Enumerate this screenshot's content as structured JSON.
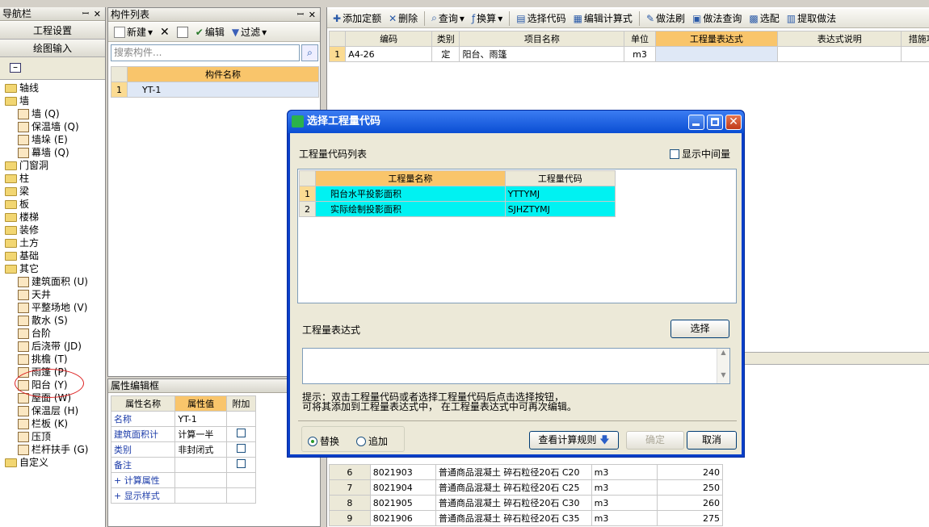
{
  "left_panel": {
    "title": "导航栏",
    "buttons": [
      "工程设置",
      "绘图输入"
    ],
    "tree": [
      {
        "label": "轴线",
        "type": "folder",
        "level": 0
      },
      {
        "label": "墙",
        "type": "folder",
        "level": 0
      },
      {
        "label": "墙 (Q)",
        "type": "item",
        "level": 1
      },
      {
        "label": "保温墙 (Q)",
        "type": "item",
        "level": 1
      },
      {
        "label": "墙垛 (E)",
        "type": "item",
        "level": 1
      },
      {
        "label": "幕墙 (Q)",
        "type": "item",
        "level": 1
      },
      {
        "label": "门窗洞",
        "type": "folder",
        "level": 0
      },
      {
        "label": "柱",
        "type": "folder",
        "level": 0
      },
      {
        "label": "梁",
        "type": "folder",
        "level": 0
      },
      {
        "label": "板",
        "type": "folder",
        "level": 0
      },
      {
        "label": "楼梯",
        "type": "folder",
        "level": 0
      },
      {
        "label": "装修",
        "type": "folder",
        "level": 0
      },
      {
        "label": "土方",
        "type": "folder",
        "level": 0
      },
      {
        "label": "基础",
        "type": "folder",
        "level": 0
      },
      {
        "label": "其它",
        "type": "folder",
        "level": 0
      },
      {
        "label": "建筑面积 (U)",
        "type": "item",
        "level": 1
      },
      {
        "label": "天井",
        "type": "item",
        "level": 1
      },
      {
        "label": "平整场地 (V)",
        "type": "item",
        "level": 1
      },
      {
        "label": "散水 (S)",
        "type": "item",
        "level": 1
      },
      {
        "label": "台阶",
        "type": "item",
        "level": 1
      },
      {
        "label": "后浇带 (JD)",
        "type": "item",
        "level": 1
      },
      {
        "label": "挑檐 (T)",
        "type": "item",
        "level": 1
      },
      {
        "label": "雨篷 (P)",
        "type": "item",
        "level": 1
      },
      {
        "label": "阳台 (Y)",
        "type": "item",
        "level": 1
      },
      {
        "label": "屋面 (W)",
        "type": "item",
        "level": 1
      },
      {
        "label": "保温层 (H)",
        "type": "item",
        "level": 1
      },
      {
        "label": "栏板 (K)",
        "type": "item",
        "level": 1
      },
      {
        "label": "压顶",
        "type": "item",
        "level": 1
      },
      {
        "label": "栏杆扶手 (G)",
        "type": "item",
        "level": 1
      },
      {
        "label": "自定义",
        "type": "folder",
        "level": 0
      }
    ]
  },
  "component_list": {
    "title": "构件列表",
    "toolbar": {
      "new": "新建",
      "edit": "编辑",
      "filter": "过滤"
    },
    "search_placeholder": "搜索构件...",
    "header": "构件名称",
    "rows": [
      {
        "n": "1",
        "name": "YT-1"
      }
    ]
  },
  "property_panel": {
    "title": "属性编辑框",
    "headers": [
      "属性名称",
      "属性值",
      "附加"
    ],
    "rows": [
      {
        "n": "",
        "name": "名称",
        "val": "YT-1",
        "check": false,
        "has_check": false
      },
      {
        "n": "",
        "name": "建筑面积计",
        "val": "计算一半",
        "check": false,
        "has_check": true
      },
      {
        "n": "",
        "name": "类别",
        "val": "非封闭式",
        "check": false,
        "has_check": true
      },
      {
        "n": "",
        "name": "备注",
        "val": "",
        "check": false,
        "has_check": true
      },
      {
        "n": "+",
        "name": "计算属性",
        "val": "",
        "check": false,
        "has_check": false
      },
      {
        "n": "+",
        "name": "显示样式",
        "val": "",
        "check": false,
        "has_check": false
      }
    ]
  },
  "main_toolbar": [
    "添加定额",
    "删除",
    "查询",
    "换算",
    "选择代码",
    "编辑计算式",
    "做法刷",
    "做法查询",
    "选配",
    "提取做法"
  ],
  "main_grid": {
    "headers": [
      "编码",
      "类别",
      "项目名称",
      "单位",
      "工程量表达式",
      "表达式说明",
      "措施项"
    ],
    "rows": [
      {
        "n": "1",
        "code": "A4-26",
        "type": "定",
        "name": "阳台、雨篷",
        "unit": "m3",
        "expr": "",
        "desc": ""
      }
    ]
  },
  "lower_grid": {
    "rows": [
      {
        "n": "6",
        "code": "8021903",
        "name": "普通商品混凝土 碎石粒径20石 C20",
        "unit": "m3",
        "price": "240"
      },
      {
        "n": "7",
        "code": "8021904",
        "name": "普通商品混凝土 碎石粒径20石 C25",
        "unit": "m3",
        "price": "250"
      },
      {
        "n": "8",
        "code": "8021905",
        "name": "普通商品混凝土 碎石粒径20石 C30",
        "unit": "m3",
        "price": "260"
      },
      {
        "n": "9",
        "code": "8021906",
        "name": "普通商品混凝土 碎石粒径20石 C35",
        "unit": "m3",
        "price": "275"
      }
    ]
  },
  "dialog": {
    "title": "选择工程量代码",
    "list_label": "工程量代码列表",
    "show_mid": "显示中间量",
    "headers": [
      "工程量名称",
      "工程量代码"
    ],
    "rows": [
      {
        "n": "1",
        "name": "阳台水平投影面积",
        "code": "YTTYMJ"
      },
      {
        "n": "2",
        "name": "实际绘制投影面积",
        "code": "SJHZTYMJ"
      }
    ],
    "expr_label": "工程量表达式",
    "select_btn": "选择",
    "hint1": "提示：双击工程量代码或者选择工程量代码后点击选择按钮，",
    "hint2": "可将其添加到工程量表达式中， 在工程量表达式中可再次编辑。",
    "replace": "替换",
    "append": "追加",
    "rules_btn": "查看计算规则",
    "ok": "确定",
    "cancel": "取消"
  }
}
